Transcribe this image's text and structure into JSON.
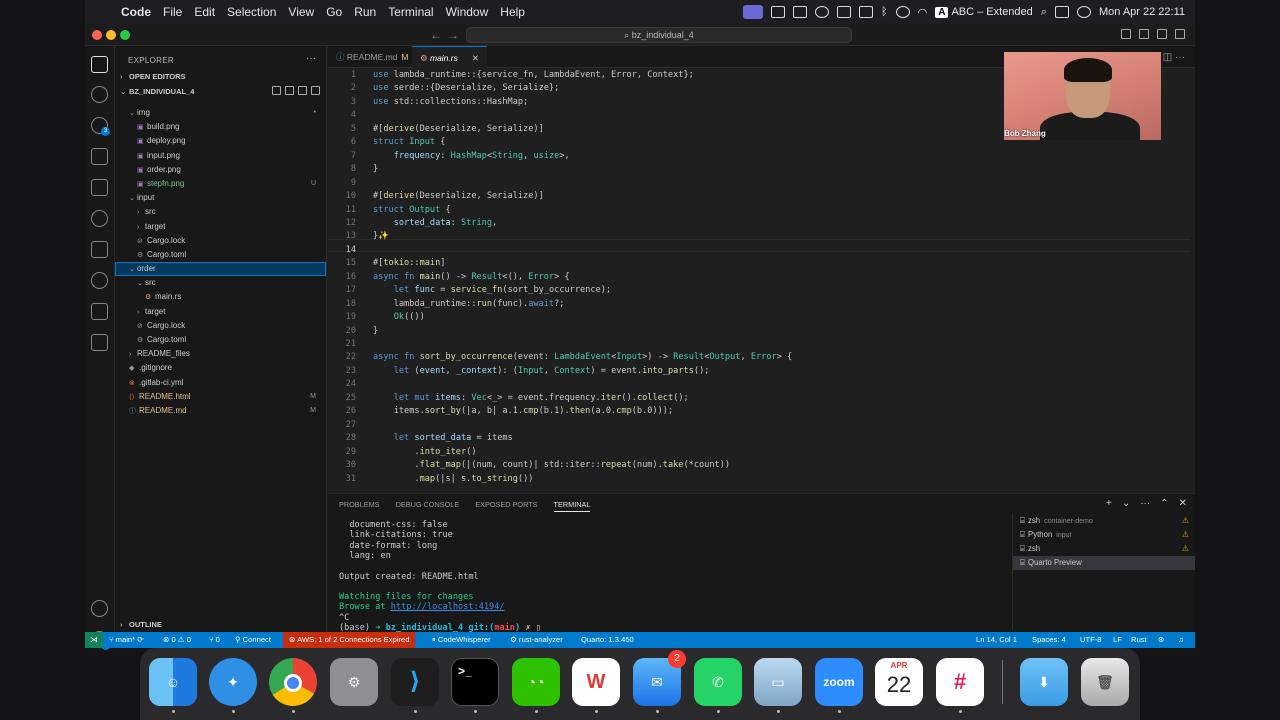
{
  "menubar": {
    "items": [
      "Code",
      "File",
      "Edit",
      "Selection",
      "View",
      "Go",
      "Run",
      "Terminal",
      "Window",
      "Help"
    ],
    "input_source": "ABC – Extended",
    "clock": "Mon Apr 22  22:11"
  },
  "window": {
    "title": "bz_individual_4"
  },
  "sidebar": {
    "title": "EXPLORER",
    "open_editors": "OPEN EDITORS",
    "project": "BZ_INDIVIDUAL_4",
    "outline": "OUTLINE",
    "tree": [
      {
        "label": "img",
        "kind": "folder",
        "depth": 1,
        "badge": "•"
      },
      {
        "label": "build.png",
        "kind": "img",
        "depth": 2,
        "badge": ""
      },
      {
        "label": "deploy.png",
        "kind": "img",
        "depth": 2,
        "badge": ""
      },
      {
        "label": "input.png",
        "kind": "img",
        "depth": 2,
        "badge": ""
      },
      {
        "label": "order.png",
        "kind": "img",
        "depth": 2,
        "badge": ""
      },
      {
        "label": "stepfn.png",
        "kind": "img",
        "depth": 2,
        "badge": "U"
      },
      {
        "label": "input",
        "kind": "folder",
        "depth": 1,
        "badge": ""
      },
      {
        "label": "src",
        "kind": "folder-closed",
        "depth": 2,
        "badge": ""
      },
      {
        "label": "target",
        "kind": "folder-closed",
        "depth": 2,
        "badge": ""
      },
      {
        "label": "Cargo.lock",
        "kind": "lock",
        "depth": 2,
        "badge": ""
      },
      {
        "label": "Cargo.toml",
        "kind": "toml",
        "depth": 2,
        "badge": ""
      },
      {
        "label": "order",
        "kind": "folder",
        "depth": 1,
        "badge": ""
      },
      {
        "label": "src",
        "kind": "folder",
        "depth": 2,
        "badge": ""
      },
      {
        "label": "main.rs",
        "kind": "rs",
        "depth": 3,
        "badge": ""
      },
      {
        "label": "target",
        "kind": "folder-closed",
        "depth": 2,
        "badge": ""
      },
      {
        "label": "Cargo.lock",
        "kind": "lock",
        "depth": 2,
        "badge": ""
      },
      {
        "label": "Cargo.toml",
        "kind": "toml",
        "depth": 2,
        "badge": ""
      },
      {
        "label": "README_files",
        "kind": "folder-closed",
        "depth": 1,
        "badge": ""
      },
      {
        "label": ".gitignore",
        "kind": "git",
        "depth": 1,
        "badge": ""
      },
      {
        "label": ".gitlab-ci.yml",
        "kind": "yml",
        "depth": 1,
        "badge": ""
      },
      {
        "label": "README.html",
        "kind": "html",
        "depth": 1,
        "badge": "M"
      },
      {
        "label": "README.md",
        "kind": "md",
        "depth": 1,
        "badge": "M"
      }
    ]
  },
  "tabs": [
    {
      "label": "README.md",
      "modified": "M"
    },
    {
      "label": "main.rs",
      "modified": ""
    }
  ],
  "code": [
    {
      "n": "1",
      "html": "<span class='kw'>use</span> lambda_runtime::{service_fn, LambdaEvent, Error, Context};"
    },
    {
      "n": "2",
      "html": "<span class='kw'>use</span> serde::{Deserialize, Serialize};"
    },
    {
      "n": "3",
      "html": "<span class='kw'>use</span> std::collections::HashMap;"
    },
    {
      "n": "4",
      "html": ""
    },
    {
      "n": "5",
      "html": "#[<span class='ma'>derive</span>(Deserialize, Serialize)]"
    },
    {
      "n": "6",
      "html": "<span class='kw'>struct</span> <span class='ty'>Input</span> {"
    },
    {
      "n": "7",
      "html": "    <span class='at'>frequency</span>: <span class='ty'>HashMap</span>&lt;<span class='ty'>String</span>, <span class='ty'>usize</span>&gt;,"
    },
    {
      "n": "8",
      "html": "}"
    },
    {
      "n": "9",
      "html": ""
    },
    {
      "n": "10",
      "html": "#[<span class='ma'>derive</span>(Deserialize, Serialize)]"
    },
    {
      "n": "11",
      "html": "<span class='kw'>struct</span> <span class='ty'>Output</span> {"
    },
    {
      "n": "12",
      "html": "    <span class='at'>sorted_data</span>: <span class='ty'>String</span>,"
    },
    {
      "n": "13",
      "html": "}<span style='color:#e2c08d'>✨</span>"
    },
    {
      "n": "14",
      "html": ""
    },
    {
      "n": "15",
      "html": "#[<span class='ma'>tokio::main</span>]"
    },
    {
      "n": "16",
      "html": "<span class='kw'>async fn</span> <span class='fn'>main</span>() -&gt; <span class='ty'>Result</span>&lt;(), <span class='ty'>Error</span>&gt; {"
    },
    {
      "n": "17",
      "html": "    <span class='kw'>let</span> <span class='at'>func</span> = <span class='fn'>service_fn</span>(sort_by_occurrence);"
    },
    {
      "n": "18",
      "html": "    lambda_runtime::<span class='fn'>run</span>(func).<span class='kw'>await</span>?;"
    },
    {
      "n": "19",
      "html": "    <span class='ty'>Ok</span>(())"
    },
    {
      "n": "20",
      "html": "}"
    },
    {
      "n": "21",
      "html": ""
    },
    {
      "n": "22",
      "html": "<span class='kw'>async fn</span> <span class='fn'>sort_by_occurrence</span>(event: <span class='ty'>LambdaEvent</span>&lt;<span class='ty'>Input</span>&gt;) -&gt; <span class='ty'>Result</span>&lt;<span class='ty'>Output</span>, <span class='ty'>Error</span>&gt; {"
    },
    {
      "n": "23",
      "html": "    <span class='kw'>let</span> (<span class='at'>event</span>, <span class='at'>_context</span>): (<span class='ty'>Input</span>, <span class='ty'>Context</span>) = event.<span class='fn'>into_parts</span>();"
    },
    {
      "n": "24",
      "html": ""
    },
    {
      "n": "25",
      "html": "    <span class='kw'>let mut</span> <span class='at'>items</span>: <span class='ty'>Vec</span>&lt;_&gt; = event.frequency.<span class='fn'>iter</span>().<span class='fn'>collect</span>();"
    },
    {
      "n": "26",
      "html": "    items.<span class='fn'>sort_by</span>(|a, b| a.1.<span class='fn'>cmp</span>(b.1).<span class='fn'>then</span>(a.0.<span class='fn'>cmp</span>(b.0)));"
    },
    {
      "n": "27",
      "html": ""
    },
    {
      "n": "28",
      "html": "    <span class='kw'>let</span> <span class='at'>sorted_data</span> = items"
    },
    {
      "n": "29",
      "html": "        .<span class='fn'>into_iter</span>()"
    },
    {
      "n": "30",
      "html": "        .<span class='fn'>flat_map</span>(|(num, count)| std::iter::<span class='fn'>repeat</span>(num).<span class='fn'>take</span>(*count))"
    },
    {
      "n": "31",
      "html": "        .<span class='fn'>map</span>(|s| s.<span class='fn'>to_string</span>())"
    }
  ],
  "panel": {
    "tabs": [
      "PROBLEMS",
      "DEBUG CONSOLE",
      "EXPOSED PORTS",
      "TERMINAL"
    ],
    "terminal_lines": [
      "  document-css: false",
      "  link-citations: true",
      "  date-format: long",
      "  lang: en",
      "",
      "Output created: README.html",
      "",
      "Watching files for changes",
      "Browse at ",
      "^C"
    ],
    "browse_url": "http://localhost:4194/",
    "prompt": {
      "env": "(base)",
      "arrow": "➜",
      "dir": "bz_individual_4",
      "git": "git:(",
      "branch": "main",
      "close": ")",
      "x": "✗"
    },
    "terminals": [
      {
        "name": "zsh",
        "sub": "container-demo",
        "warn": "⚠"
      },
      {
        "name": "Python",
        "sub": "input",
        "warn": "⚠"
      },
      {
        "name": "zsh",
        "sub": "",
        "warn": "⚠"
      },
      {
        "name": "Quarto Preview",
        "sub": "",
        "warn": ""
      }
    ]
  },
  "statusbar": {
    "branch": "main*",
    "problems": "⊗ 0 ⚠ 0",
    "ports": "⑂ 0",
    "connect": "Connect",
    "aws": "AWS: 1 of 2 Connections Expired",
    "codewhisperer": "CodeWhisperer",
    "rust_analyzer": "rust-analyzer",
    "quarto": "Quarto: 1.3.450",
    "cursor": "Ln 14, Col 1",
    "spaces": "Spaces: 4",
    "encoding": "UTF-8",
    "eol": "LF",
    "language": "Rust"
  },
  "video": {
    "name": "Bob Zhang"
  },
  "dock": {
    "mail_badge": "2",
    "calendar_month": "APR",
    "calendar_day": "22",
    "zoom_label": "zoom"
  },
  "colors": {
    "accent": "#007acc",
    "selection": "#04395e",
    "aws_warning": "#c72e0f"
  }
}
